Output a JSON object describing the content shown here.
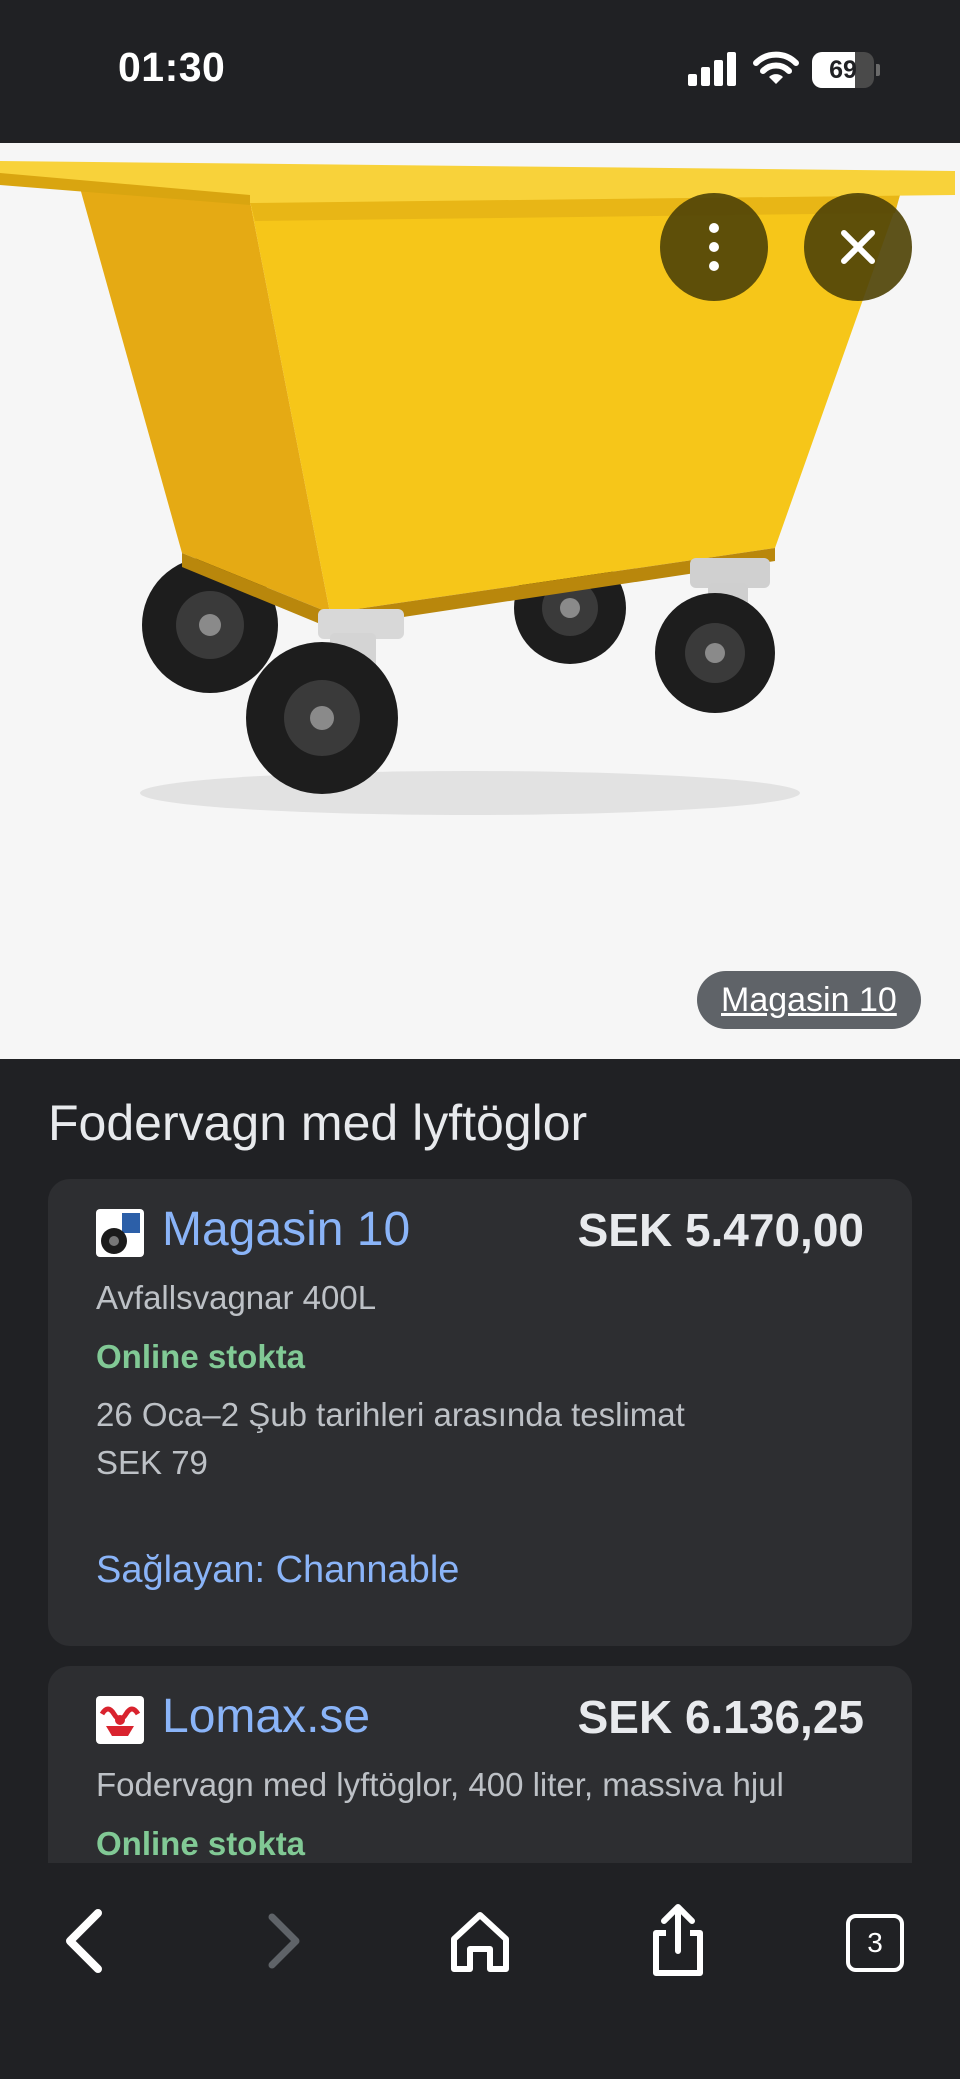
{
  "status_bar": {
    "time": "01:30",
    "battery_level": "69",
    "battery_fraction": 0.69
  },
  "viewer": {
    "source_chip": "Magasin 10",
    "more_icon": "more-vertical-icon",
    "close_icon": "close-icon"
  },
  "product": {
    "title": "Fodervagn med lyftöglor"
  },
  "offers": [
    {
      "seller": "Magasin 10",
      "price": "SEK 5.470,00",
      "subtitle": "Avfallsvagnar 400L",
      "stock": "Online stokta",
      "delivery": "26 Oca–2 Şub tarihleri arasında teslimat",
      "shipping": "SEK 79",
      "provider": "Sağlayan: Channable"
    },
    {
      "seller": "Lomax.se",
      "price": "SEK 6.136,25",
      "subtitle": "Fodervagn med lyftöglor, 400 liter, massiva hjul",
      "stock": "Online stokta"
    }
  ],
  "toolbar": {
    "back_icon": "chevron-left-icon",
    "forward_icon": "chevron-right-icon",
    "home_icon": "home-icon",
    "share_icon": "share-icon",
    "tabs_count": "3"
  },
  "colors": {
    "background": "#202124",
    "card": "#2d2e31",
    "link": "#8ab4f8",
    "in_stock": "#81c995",
    "cart_yellow": "#f6c619"
  }
}
